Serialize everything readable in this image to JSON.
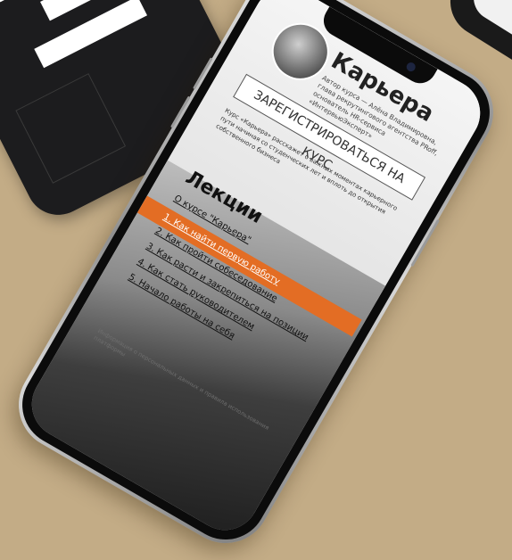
{
  "course": {
    "title": "Карьера",
    "author_line": "Автор курса — Алёна Владимировна,",
    "author_line2": "глава рекрутингового агентства PRoff,",
    "author_line3": "основатель HR-сервиса «ИнтервьюЭксперт»",
    "register_label": "ЗАРЕГИСТРИРОВАТЬСЯ НА КУРС",
    "description": "Курс «Карьера» расскажет о важных моментах карьерного пути начиная со студенческих лет и вплоть до открытия собственного бизнеса"
  },
  "lectures": {
    "heading": "Лекции",
    "items": [
      {
        "label": "О курсе \"Карьера\"",
        "active": false
      },
      {
        "label": "1. Как найти первую работу",
        "active": true
      },
      {
        "label": "2. Как пройти собеседование",
        "active": false
      },
      {
        "label": "3. Как расти и закрепиться на позиции",
        "active": false
      },
      {
        "label": "4. Как стать руководителем",
        "active": false
      },
      {
        "label": "5. Начало работы на себя",
        "active": false
      }
    ]
  },
  "footer": {
    "text": "Информация о персональных данных и правила использования платформы"
  },
  "colors": {
    "background": "#c3ac86",
    "accent": "#e36d24",
    "phone_bezel": "#0b0b0b"
  }
}
